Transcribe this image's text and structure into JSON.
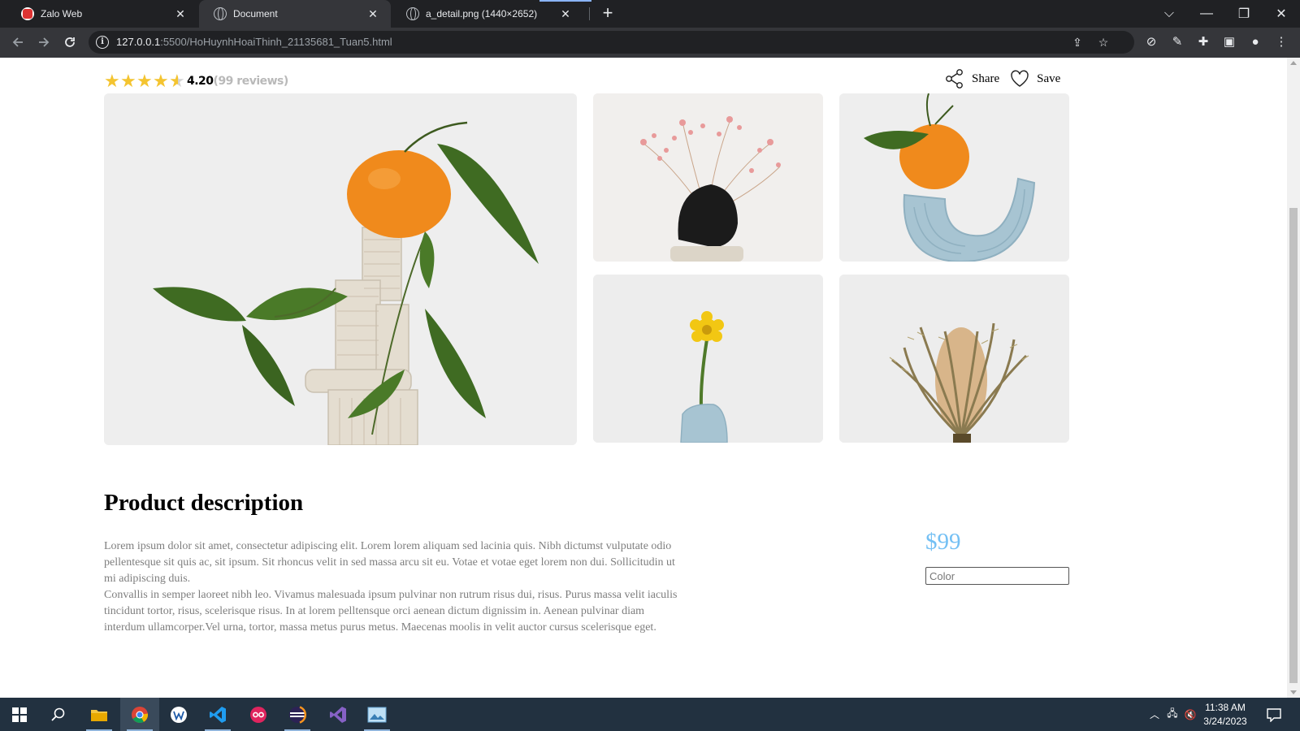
{
  "browser": {
    "tabs": [
      {
        "title": "Zalo Web",
        "close": "✕"
      },
      {
        "title": "Document",
        "close": "✕"
      },
      {
        "title": "a_detail.png (1440×2652)",
        "close": "✕"
      }
    ],
    "new_tab": "+",
    "url_host": "127.0.0.1",
    "url_path": ":5500/HoHuynhHoaiThinh_21135681_Tuan5.html",
    "window_controls": {
      "dropdown": "⌵",
      "minimize": "—",
      "restore": "❐",
      "close": "✕"
    }
  },
  "product": {
    "rating_value": "4.20",
    "rating_count": "(99 reviews)",
    "stars_filled": 4.5,
    "share_label": "Share",
    "save_label": "Save"
  },
  "description": {
    "title": "Product description",
    "paragraph1": "Lorem ipsum dolor sit amet, consectetur adipiscing elit. Lorem lorem aliquam sed lacinia quis. Nibh dictumst vulputate odio pellentesque sit quis ac, sit ipsum. Sit rhoncus velit in sed massa arcu sit eu. Votae et votae eget lorem non dui. Sollicitudin ut mi adipiscing duis.",
    "paragraph2": "Convallis in semper laoreet nibh leo. Vivamus malesuada ipsum pulvinar non rutrum risus dui, risus. Purus massa velit iaculis tincidunt tortor, risus, scelerisque risus. In at lorem pelltensque orci aenean dictum dignissim in. Aenean pulvinar diam interdum ullamcorper.Vel urna, tortor, massa metus purus metus. Maecenas moolis in velit auctor cursus scelerisque eget."
  },
  "purchase": {
    "price": "$99",
    "color_placeholder": "Color"
  },
  "taskbar": {
    "time": "11:38 AM",
    "date": "3/24/2023"
  },
  "colors": {
    "star": "#f4c430",
    "price": "#74c0f4",
    "taskbar": "#223140",
    "chrome_dark": "#202124",
    "chrome_toolbar": "#35363a"
  }
}
